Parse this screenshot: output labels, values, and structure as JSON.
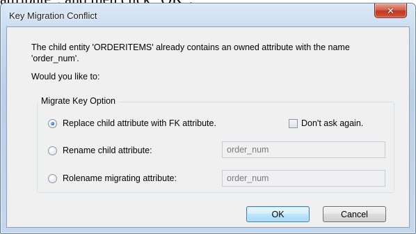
{
  "background_text": "attribute\", and then click \"OK\".",
  "window": {
    "title": "Key Migration Conflict"
  },
  "message": "The child entity 'ORDERITEMS' already contains an owned attribute with the name 'order_num'.",
  "prompt": "Would you like to:",
  "group": {
    "title": "Migrate Key Option",
    "options": [
      {
        "label": "Replace child attribute with FK attribute.",
        "checked": true
      },
      {
        "label": "Rename child attribute:",
        "checked": false,
        "value": "order_num"
      },
      {
        "label": "Rolename migrating attribute:",
        "checked": false,
        "value": "order_num"
      }
    ],
    "dont_ask": {
      "label": "Don't ask again.",
      "checked": false
    }
  },
  "buttons": {
    "ok": "OK",
    "cancel": "Cancel"
  },
  "colors": {
    "title_bar": "#c7daf0",
    "close_button": "#c0381f",
    "client_bg": "#f0f0f0",
    "default_button_border": "#3c7fb1"
  }
}
